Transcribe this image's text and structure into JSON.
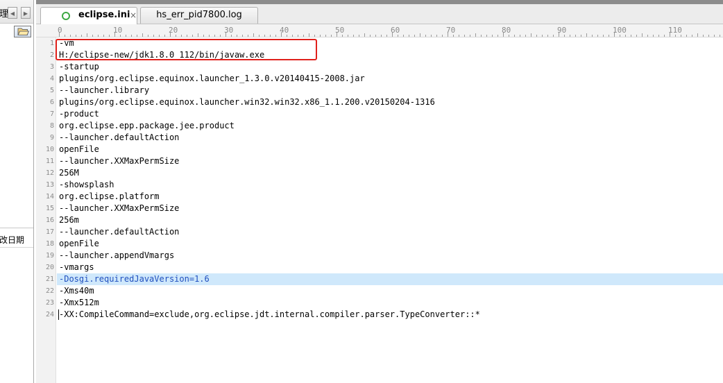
{
  "left_panel": {
    "header_text": "理",
    "column_text": "改日期"
  },
  "tabs": [
    {
      "label": "eclipse.ini",
      "close": "×",
      "active": true
    },
    {
      "label": "hs_err_pid7800.log",
      "active": false
    }
  ],
  "ruler_labels": [
    "0",
    "10",
    "20",
    "30",
    "40",
    "50",
    "60",
    "70",
    "80",
    "90",
    "100",
    "110"
  ],
  "editor": {
    "highlighted_line": 21,
    "lines": [
      "-vm",
      "H:/eclipse-new/jdk1.8.0_112/bin/javaw.exe",
      "-startup",
      "plugins/org.eclipse.equinox.launcher_1.3.0.v20140415-2008.jar",
      "--launcher.library",
      "plugins/org.eclipse.equinox.launcher.win32.win32.x86_1.1.200.v20150204-1316",
      "-product",
      "org.eclipse.epp.package.jee.product",
      "--launcher.defaultAction",
      "openFile",
      "--launcher.XXMaxPermSize",
      "256M",
      "-showsplash",
      "org.eclipse.platform",
      "--launcher.XXMaxPermSize",
      "256m",
      "--launcher.defaultAction",
      "openFile",
      "--launcher.appendVmargs",
      "-vmargs",
      "-Dosgi.requiredJavaVersion=1.6",
      "-Xms40m",
      "-Xmx512m",
      "-XX:CompileCommand=exclude,org.eclipse.jdt.internal.compiler.parser.TypeConverter::*"
    ]
  },
  "colors": {
    "highlight_bg": "#cfe8fb",
    "highlight_text": "#1f4fbf",
    "annotation_box": "#e0201b",
    "tab_icon": "#3da843"
  }
}
